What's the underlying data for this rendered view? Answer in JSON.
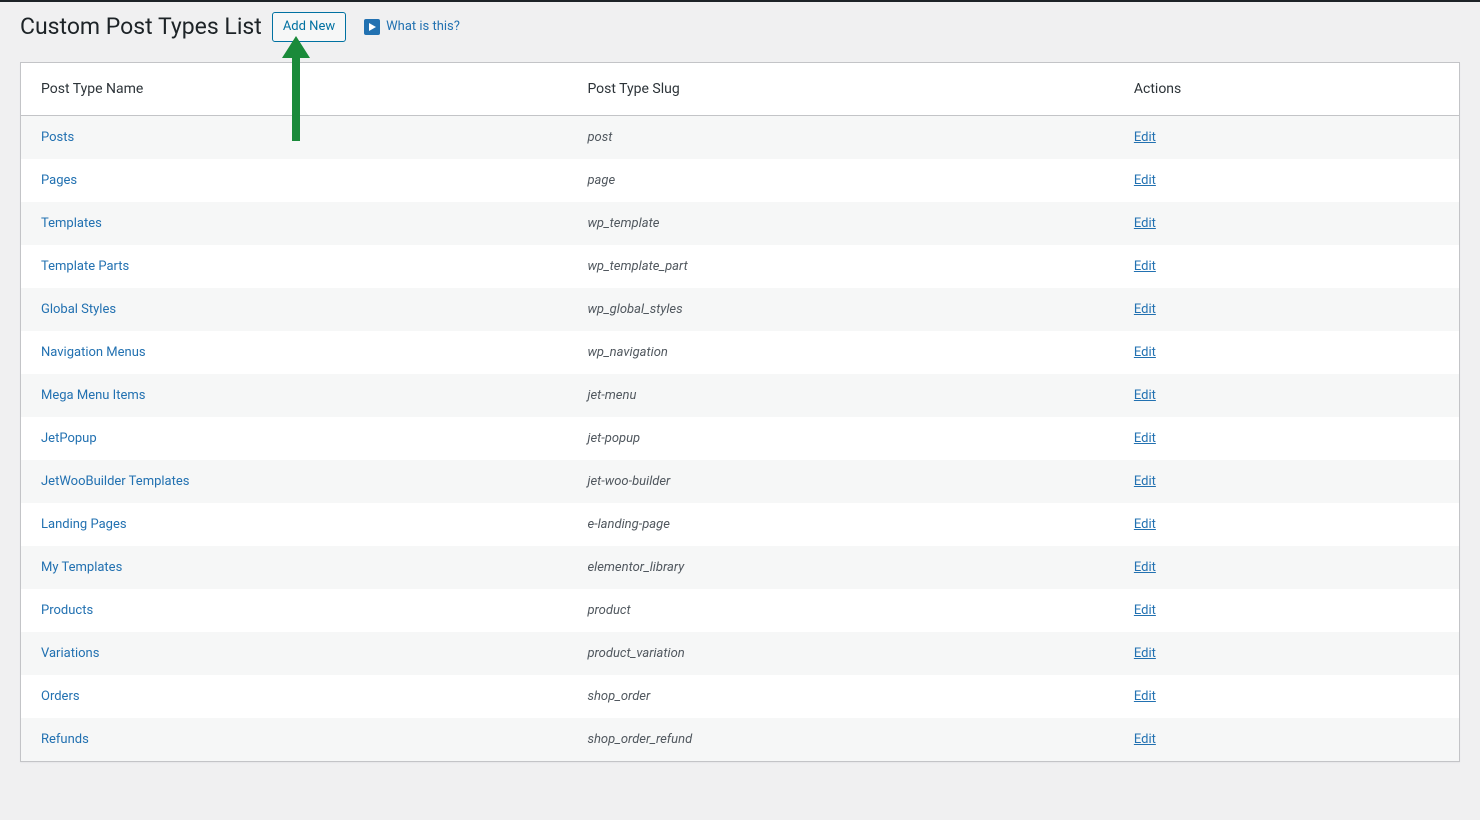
{
  "page": {
    "title": "Custom Post Types List",
    "add_new_label": "Add New",
    "help_label": "What is this?"
  },
  "table": {
    "columns": {
      "name": "Post Type Name",
      "slug": "Post Type Slug",
      "actions": "Actions"
    },
    "edit_label": "Edit",
    "rows": [
      {
        "name": "Posts",
        "slug": "post"
      },
      {
        "name": "Pages",
        "slug": "page"
      },
      {
        "name": "Templates",
        "slug": "wp_template"
      },
      {
        "name": "Template Parts",
        "slug": "wp_template_part"
      },
      {
        "name": "Global Styles",
        "slug": "wp_global_styles"
      },
      {
        "name": "Navigation Menus",
        "slug": "wp_navigation"
      },
      {
        "name": "Mega Menu Items",
        "slug": "jet-menu"
      },
      {
        "name": "JetPopup",
        "slug": "jet-popup"
      },
      {
        "name": "JetWooBuilder Templates",
        "slug": "jet-woo-builder"
      },
      {
        "name": "Landing Pages",
        "slug": "e-landing-page"
      },
      {
        "name": "My Templates",
        "slug": "elementor_library"
      },
      {
        "name": "Products",
        "slug": "product"
      },
      {
        "name": "Variations",
        "slug": "product_variation"
      },
      {
        "name": "Orders",
        "slug": "shop_order"
      },
      {
        "name": "Refunds",
        "slug": "shop_order_refund"
      }
    ]
  }
}
